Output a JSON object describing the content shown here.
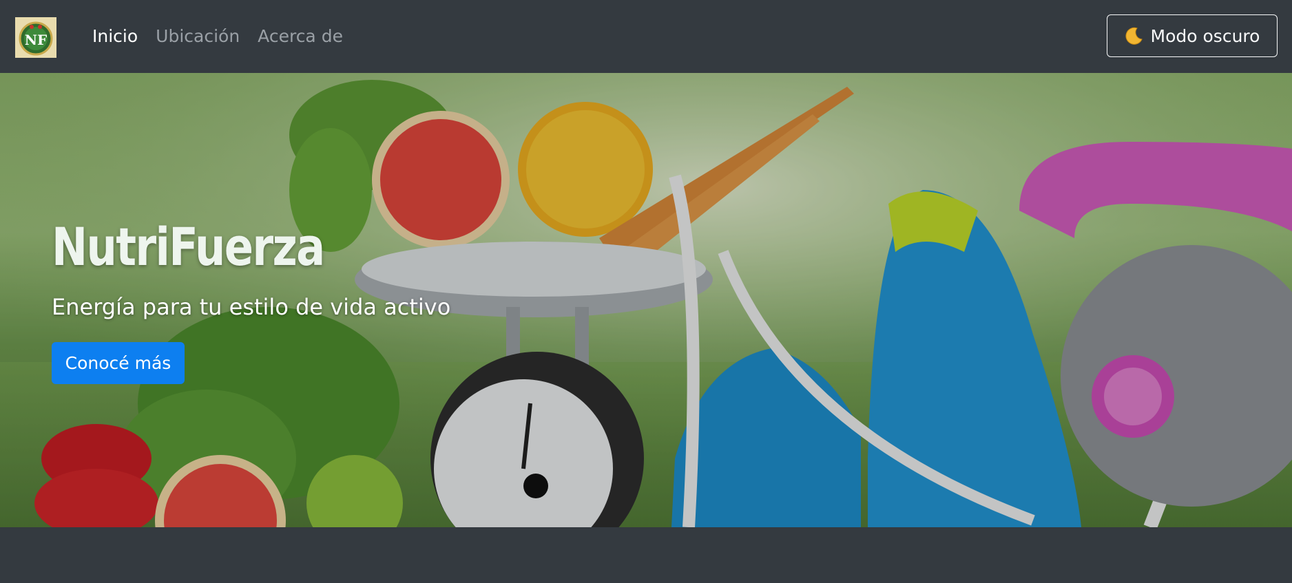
{
  "navbar": {
    "logo_text": "NF",
    "links": [
      {
        "label": "Inicio",
        "active": true
      },
      {
        "label": "Ubicación",
        "active": false
      },
      {
        "label": "Acerca de",
        "active": false
      }
    ],
    "dark_mode_label": "Modo oscuro",
    "dark_mode_icon": "moon-icon"
  },
  "hero": {
    "title": "NutriFuerza",
    "subtitle": "Energía para tu estilo de vida activo",
    "cta_label": "Conocé más"
  },
  "colors": {
    "navbar_bg": "#343a40",
    "cta_bg": "#0d7ff0",
    "text_light": "#ffffff"
  }
}
